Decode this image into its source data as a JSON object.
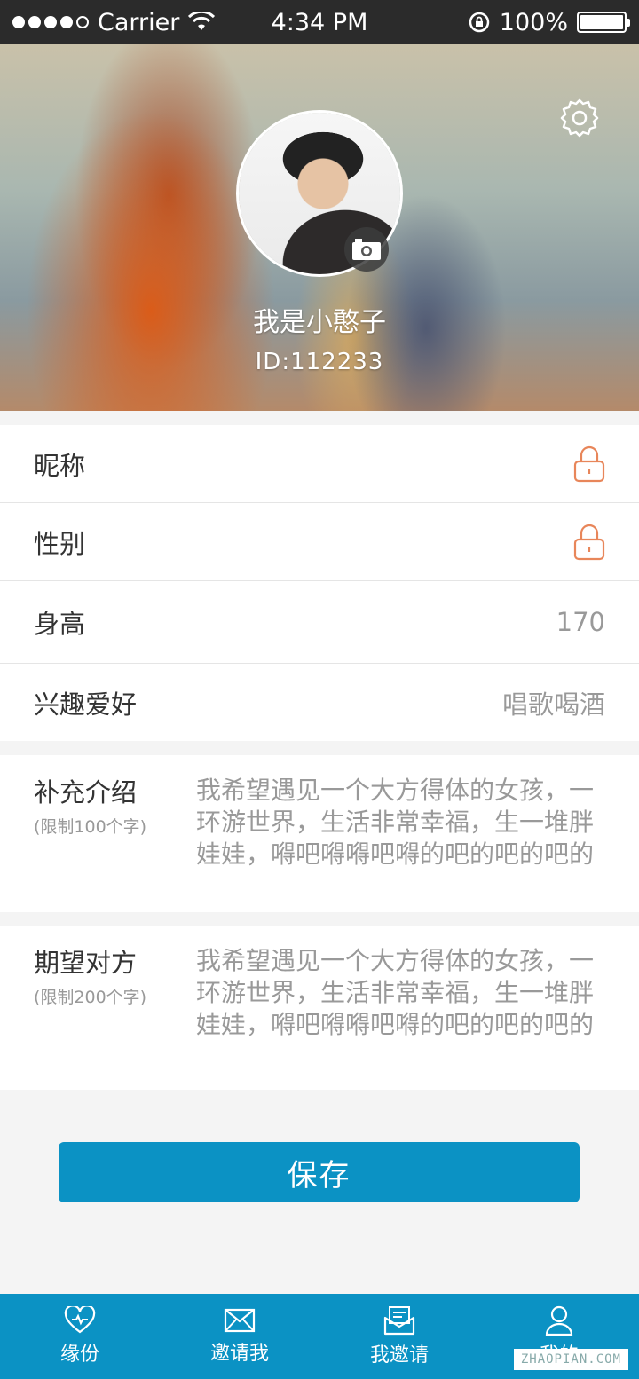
{
  "status_bar": {
    "carrier": "Carrier",
    "time": "4:34 PM",
    "battery": "100%"
  },
  "profile": {
    "name": "我是小憨子",
    "id": "ID:112233"
  },
  "fields": [
    {
      "label": "昵称",
      "value": "",
      "locked": true
    },
    {
      "label": "性别",
      "value": "",
      "locked": true
    },
    {
      "label": "身高",
      "value": "170",
      "locked": false
    },
    {
      "label": "兴趣爱好",
      "value": "唱歌喝酒",
      "locked": false
    }
  ],
  "intro": {
    "label": "补充介绍",
    "limit": "(限制100个字)",
    "text": "我希望遇见一个大方得体的女孩，一环游世界，生活非常幸福，生一堆胖娃娃，嘚吧嘚嘚吧嘚的吧的吧的吧的"
  },
  "expect": {
    "label": "期望对方",
    "limit": "(限制200个字)",
    "text": "我希望遇见一个大方得体的女孩，一环游世界，生活非常幸福，生一堆胖娃娃，嘚吧嘚嘚吧嘚的吧的吧的吧的"
  },
  "save_label": "保存",
  "tabs": [
    {
      "label": "缘份",
      "icon": "heart-icon"
    },
    {
      "label": "邀请我",
      "icon": "envelope-icon"
    },
    {
      "label": "我邀请",
      "icon": "letter-icon"
    },
    {
      "label": "我的",
      "icon": "person-icon"
    }
  ],
  "watermark": "ZHAOPIAN.COM",
  "colors": {
    "accent": "#0b92c4",
    "lock": "#e8865a"
  }
}
